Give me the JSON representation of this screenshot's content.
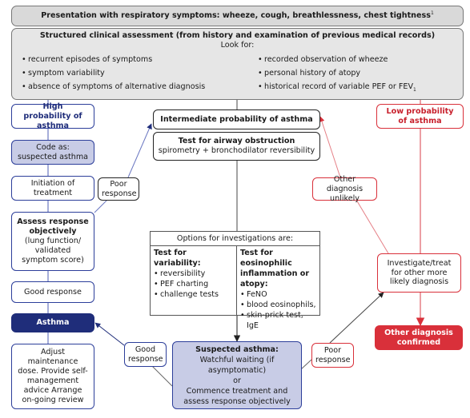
{
  "presentation": {
    "text": "Presentation with respiratory symptoms:  wheeze, cough, breathlessness, chest tightness",
    "footnote": "1"
  },
  "assessment": {
    "title": "Structured clinical assessment (from history and examination of previous medical records)",
    "look_for": "Look for:",
    "left_items": [
      "recurrent episodes of symptoms",
      "symptom variability",
      "absence of symptoms of alternative diagnosis"
    ],
    "right_items": [
      "recorded observation of wheeze",
      "personal history of atopy",
      "historical record of variable PEF or FEV"
    ],
    "fev_subscript": "1"
  },
  "high": {
    "title": "High probability of asthma",
    "code_as": [
      "Code as:",
      "suspected asthma"
    ],
    "initiation": "Initiation of treatment",
    "assess_title": "Assess response objectively",
    "assess_detail": "(lung function/ validated symptom score)",
    "good_response": "Good response",
    "asthma": "Asthma",
    "adjust": "Adjust maintenance dose. Provide self-management advice Arrange on-going review"
  },
  "poor_response_left": "Poor response",
  "intermediate": {
    "title": "Intermediate probability of asthma",
    "test_title": "Test for airway obstruction",
    "test_detail": "spirometry + bronchodilator reversibility"
  },
  "options": {
    "header": "Options for investigations are:",
    "variability_title": "Test for variability:",
    "variability_items": [
      "reversibility",
      "PEF charting",
      "challenge tests"
    ],
    "eosinophilic_title": "Test for eosinophilic inflammation or atopy:",
    "eosinophilic_items": [
      "FeNO",
      "blood eosinophils,",
      "skin-prick test, IgE"
    ]
  },
  "suspected": {
    "title": "Suspected asthma:",
    "lines": [
      "Watchful waiting (if asymptomatic)",
      "or",
      "Commence treatment and assess response objectively"
    ]
  },
  "good_response_mid": "Good response",
  "poor_response_right": "Poor response",
  "low": {
    "title": "Low probability of asthma",
    "other_unlikely": "Other diagnosis unlikely",
    "investigate": "Investigate/treat for other more likely diagnosis",
    "confirmed": "Other diagnosis confirmed"
  },
  "colors": {
    "blue": "#2c3e9a",
    "navy": "#1f2d7a",
    "lavender": "#c8cce6",
    "red": "#d9303a",
    "gray": "#d9d9d9"
  }
}
